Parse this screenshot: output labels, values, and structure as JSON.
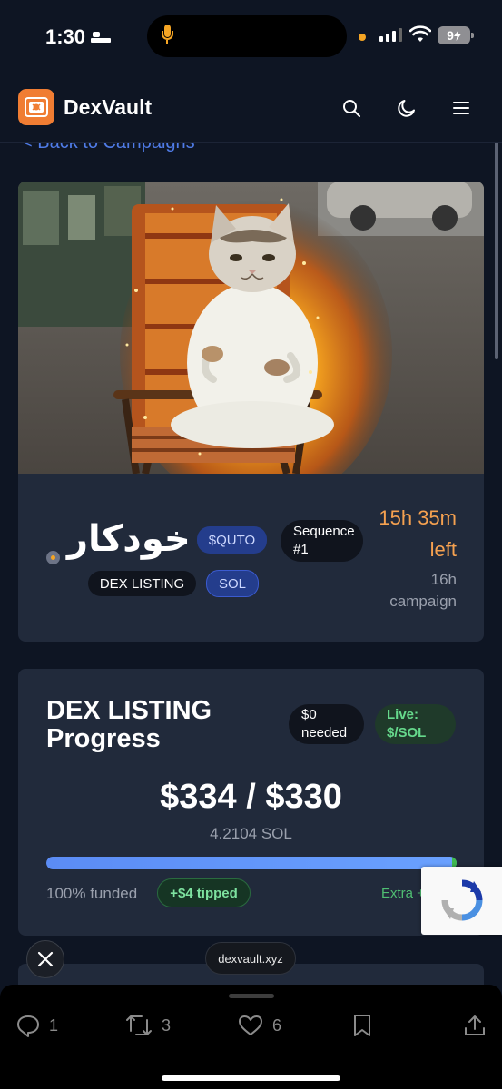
{
  "status_bar": {
    "time": "1:30",
    "battery": "9"
  },
  "header": {
    "brand": "DexVault"
  },
  "back_link": "< Back to Campaigns",
  "campaign": {
    "title": "خودكار",
    "ticker": "$QUTO",
    "sequence": [
      "Sequence",
      "#1"
    ],
    "type_badge": "DEX LISTING",
    "chain_badge": "SOL",
    "time_left": [
      "15h 35m",
      "left"
    ],
    "duration": [
      "16h",
      "campaign"
    ]
  },
  "progress": {
    "title": [
      "DEX LISTING",
      "Progress"
    ],
    "needed": [
      "$0",
      "needed"
    ],
    "live": [
      "Live:",
      "$/SOL"
    ],
    "amount": "$334 / $330",
    "sol": "4.2104 SOL",
    "percent_funded": 100,
    "funded_label": "100% funded",
    "tipped_label": "+$4 tipped",
    "extra_label": "Extra +"
  },
  "browser": {
    "url": "dexvault.xyz"
  },
  "tweet_actions": {
    "replies": "1",
    "reposts": "3",
    "likes": "6"
  },
  "colors": {
    "accent": "#f07d33",
    "progress": "#5b8cf5",
    "live": "#3fb950",
    "time": "#f5a150"
  }
}
